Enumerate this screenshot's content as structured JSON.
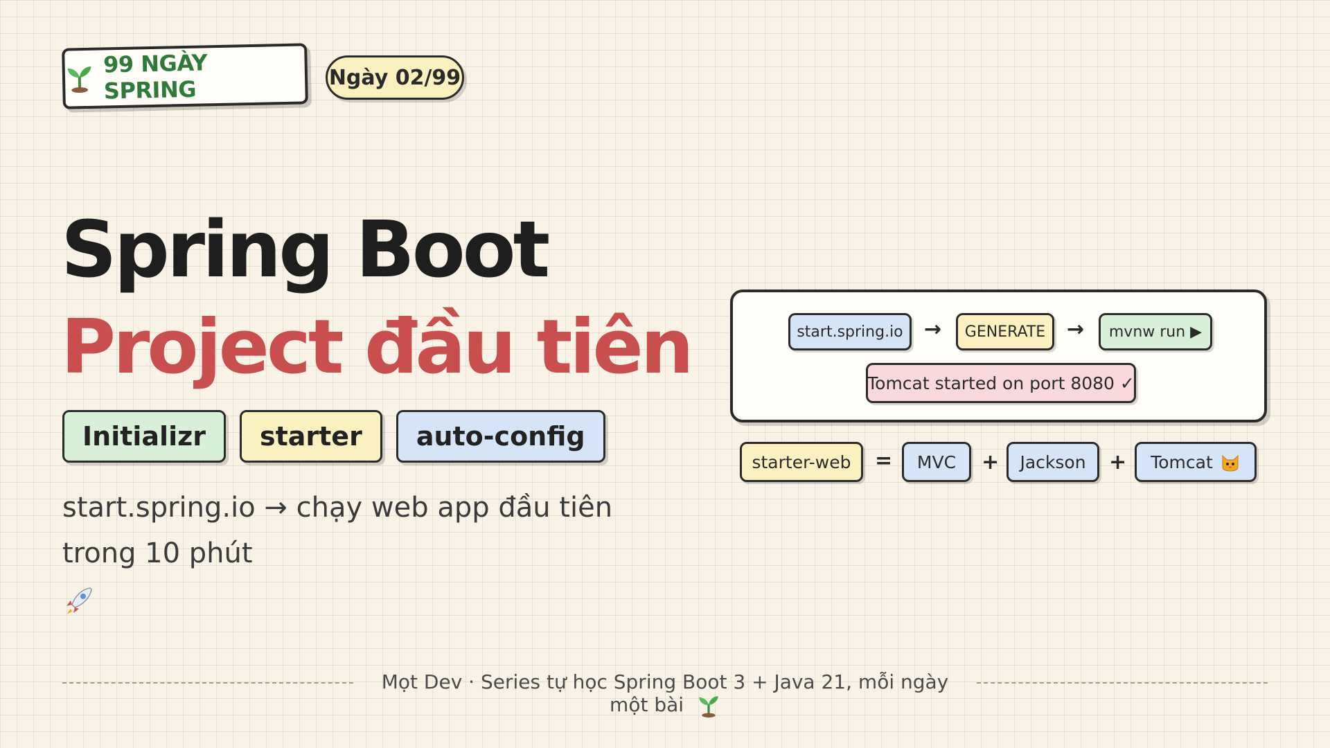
{
  "header": {
    "series_label": "99 NGÀY SPRING",
    "day_label": "Ngày 02/99"
  },
  "title": {
    "line1": "Spring Boot",
    "line2": "Project đầu tiên"
  },
  "tags": [
    "Initializr",
    "starter",
    "auto-config"
  ],
  "subtitle": "start.spring.io → chạy web app đầu tiên trong 10 phút",
  "flow": {
    "step1": "start.spring.io",
    "arrow": "→",
    "step2": "GENERATE",
    "step3": "mvnw run ▶",
    "result": "Tomcat started on port 8080 ✓"
  },
  "equation": {
    "lhs": "starter-web",
    "equals": "=",
    "plus": "+",
    "parts": [
      "MVC",
      "Jackson",
      "Tomcat"
    ]
  },
  "footer": {
    "text": "Mọt Dev · Series tự học Spring Boot 3 + Java 21, mỗi ngày một bài"
  },
  "icons": [
    "sprout-icon",
    "rocket-icon",
    "cat-icon"
  ],
  "colors": {
    "background": "#f8f3e6",
    "title_red": "#c94f4f",
    "series_green": "#2f7a3a",
    "tag_green": "#d8efd8",
    "tag_yellow": "#fbf0bf",
    "tag_blue": "#d5e4f6",
    "chip_pink": "#f9d9dc"
  }
}
